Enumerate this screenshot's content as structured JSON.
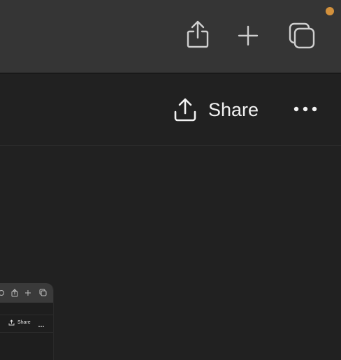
{
  "toolbar": {
    "icons": [
      "share-icon",
      "plus-icon",
      "tabs-icon"
    ],
    "notification_dot_color": "#d3913c"
  },
  "header": {
    "share_label": "Share",
    "more_icon": "ellipsis-icon"
  },
  "thumbnail": {
    "share_label": "Share",
    "toolbar_icons": [
      "history-icon",
      "share-icon",
      "plus-icon",
      "tabs-icon"
    ]
  },
  "colors": {
    "toolbar_bg": "#353535",
    "page_bg": "#212121",
    "text": "#f2f2f2"
  }
}
